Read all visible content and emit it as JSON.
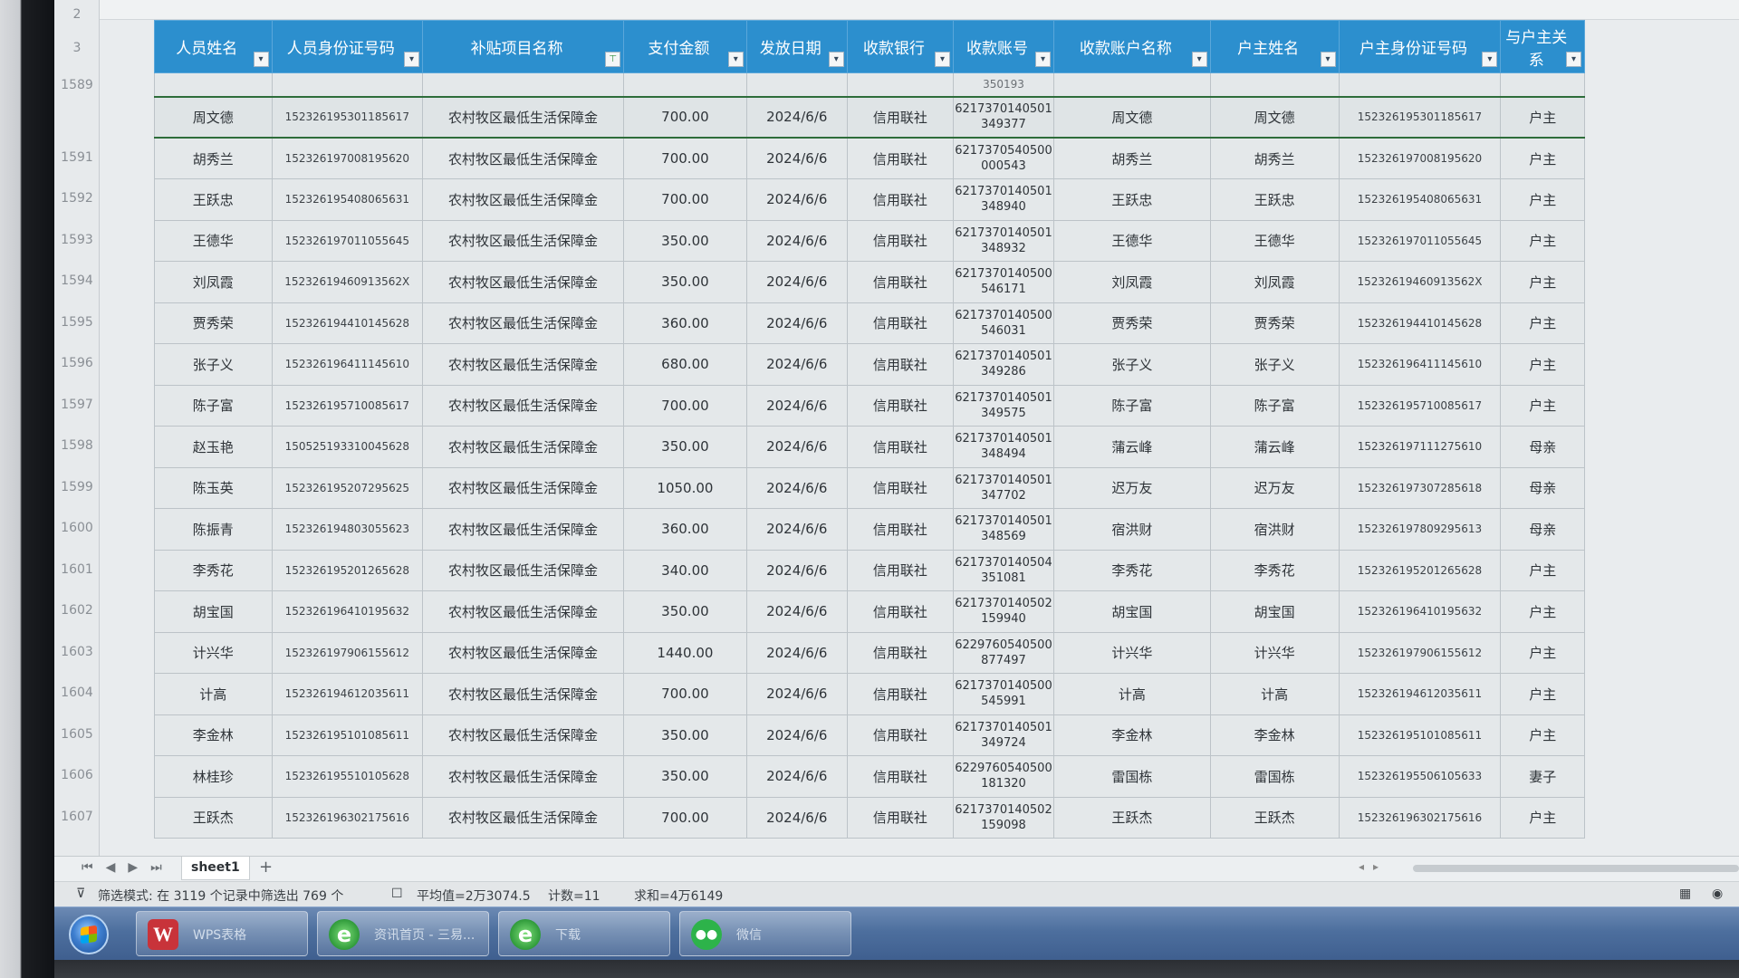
{
  "row_numbers_top": [
    "2",
    "3"
  ],
  "headers": [
    {
      "label": "人员姓名",
      "filtered": false
    },
    {
      "label": "人员身份证号码",
      "filtered": false
    },
    {
      "label": "补贴项目名称",
      "filtered": true
    },
    {
      "label": "支付金额",
      "filtered": false
    },
    {
      "label": "发放日期",
      "filtered": false
    },
    {
      "label": "收款银行",
      "filtered": false
    },
    {
      "label": "收款账号",
      "filtered": false
    },
    {
      "label": "收款账户名称",
      "filtered": false
    },
    {
      "label": "户主姓名",
      "filtered": false
    },
    {
      "label": "户主身份证号码",
      "filtered": false
    },
    {
      "label": "与户主关系",
      "filtered": false
    }
  ],
  "partial_row": {
    "num": "1589",
    "cells": [
      "",
      "",
      "",
      "",
      "",
      "",
      "350193",
      "",
      "",
      "",
      ""
    ]
  },
  "rows": [
    {
      "num": "",
      "cells": [
        "周文德",
        "152326195301185617",
        "农村牧区最低生活保障金",
        "700.00",
        "2024/6/6",
        "信用联社",
        "6217370140501\n349377",
        "周文德",
        "周文德",
        "152326195301185617",
        "户主"
      ]
    },
    {
      "num": "1591",
      "cells": [
        "胡秀兰",
        "152326197008195620",
        "农村牧区最低生活保障金",
        "700.00",
        "2024/6/6",
        "信用联社",
        "6217370540500\n000543",
        "胡秀兰",
        "胡秀兰",
        "152326197008195620",
        "户主"
      ]
    },
    {
      "num": "1592",
      "cells": [
        "王跃忠",
        "152326195408065631",
        "农村牧区最低生活保障金",
        "700.00",
        "2024/6/6",
        "信用联社",
        "6217370140501\n348940",
        "王跃忠",
        "王跃忠",
        "152326195408065631",
        "户主"
      ]
    },
    {
      "num": "1593",
      "cells": [
        "王德华",
        "152326197011055645",
        "农村牧区最低生活保障金",
        "350.00",
        "2024/6/6",
        "信用联社",
        "6217370140501\n348932",
        "王德华",
        "王德华",
        "152326197011055645",
        "户主"
      ]
    },
    {
      "num": "1594",
      "cells": [
        "刘凤霞",
        "15232619460913562X",
        "农村牧区最低生活保障金",
        "350.00",
        "2024/6/6",
        "信用联社",
        "6217370140500\n546171",
        "刘凤霞",
        "刘凤霞",
        "15232619460913562X",
        "户主"
      ]
    },
    {
      "num": "1595",
      "cells": [
        "贾秀荣",
        "152326194410145628",
        "农村牧区最低生活保障金",
        "360.00",
        "2024/6/6",
        "信用联社",
        "6217370140500\n546031",
        "贾秀荣",
        "贾秀荣",
        "152326194410145628",
        "户主"
      ]
    },
    {
      "num": "1596",
      "cells": [
        "张子义",
        "152326196411145610",
        "农村牧区最低生活保障金",
        "680.00",
        "2024/6/6",
        "信用联社",
        "6217370140501\n349286",
        "张子义",
        "张子义",
        "152326196411145610",
        "户主"
      ]
    },
    {
      "num": "1597",
      "cells": [
        "陈子富",
        "152326195710085617",
        "农村牧区最低生活保障金",
        "700.00",
        "2024/6/6",
        "信用联社",
        "6217370140501\n349575",
        "陈子富",
        "陈子富",
        "152326195710085617",
        "户主"
      ]
    },
    {
      "num": "1598",
      "cells": [
        "赵玉艳",
        "150525193310045628",
        "农村牧区最低生活保障金",
        "350.00",
        "2024/6/6",
        "信用联社",
        "6217370140501\n348494",
        "蒲云峰",
        "蒲云峰",
        "152326197111275610",
        "母亲"
      ]
    },
    {
      "num": "1599",
      "cells": [
        "陈玉英",
        "152326195207295625",
        "农村牧区最低生活保障金",
        "1050.00",
        "2024/6/6",
        "信用联社",
        "6217370140501\n347702",
        "迟万友",
        "迟万友",
        "152326197307285618",
        "母亲"
      ]
    },
    {
      "num": "1600",
      "cells": [
        "陈振青",
        "152326194803055623",
        "农村牧区最低生活保障金",
        "360.00",
        "2024/6/6",
        "信用联社",
        "6217370140501\n348569",
        "宿洪财",
        "宿洪财",
        "152326197809295613",
        "母亲"
      ]
    },
    {
      "num": "1601",
      "cells": [
        "李秀花",
        "152326195201265628",
        "农村牧区最低生活保障金",
        "340.00",
        "2024/6/6",
        "信用联社",
        "6217370140504\n351081",
        "李秀花",
        "李秀花",
        "152326195201265628",
        "户主"
      ]
    },
    {
      "num": "1602",
      "cells": [
        "胡宝国",
        "152326196410195632",
        "农村牧区最低生活保障金",
        "350.00",
        "2024/6/6",
        "信用联社",
        "6217370140502\n159940",
        "胡宝国",
        "胡宝国",
        "152326196410195632",
        "户主"
      ]
    },
    {
      "num": "1603",
      "cells": [
        "计兴华",
        "152326197906155612",
        "农村牧区最低生活保障金",
        "1440.00",
        "2024/6/6",
        "信用联社",
        "6229760540500\n877497",
        "计兴华",
        "计兴华",
        "152326197906155612",
        "户主"
      ]
    },
    {
      "num": "1604",
      "cells": [
        "计高",
        "152326194612035611",
        "农村牧区最低生活保障金",
        "700.00",
        "2024/6/6",
        "信用联社",
        "6217370140500\n545991",
        "计高",
        "计高",
        "152326194612035611",
        "户主"
      ]
    },
    {
      "num": "1605",
      "cells": [
        "李金林",
        "152326195101085611",
        "农村牧区最低生活保障金",
        "350.00",
        "2024/6/6",
        "信用联社",
        "6217370140501\n349724",
        "李金林",
        "李金林",
        "152326195101085611",
        "户主"
      ]
    },
    {
      "num": "1606",
      "cells": [
        "林桂珍",
        "152326195510105628",
        "农村牧区最低生活保障金",
        "350.00",
        "2024/6/6",
        "信用联社",
        "6229760540500\n181320",
        "雷国栋",
        "雷国栋",
        "152326195506105633",
        "妻子"
      ]
    },
    {
      "num": "1607",
      "cells": [
        "王跃杰",
        "152326196302175616",
        "农村牧区最低生活保障金",
        "700.00",
        "2024/6/6",
        "信用联社",
        "6217370140502\n159098",
        "王跃杰",
        "王跃杰",
        "152326196302175616",
        "户主"
      ]
    }
  ],
  "sheet_tab": "sheet1",
  "status": {
    "filter_text": "筛选模式: 在 3119 个记录中筛选出 769 个",
    "average": "平均值=2万3074.5",
    "count": "计数=11",
    "sum": "求和=4万6149"
  },
  "taskbar": {
    "items": [
      {
        "label": "WPS表格",
        "icon": "wps-icon"
      },
      {
        "label": "资讯首页 - 三易...",
        "icon": "ie-icon"
      },
      {
        "label": "下载",
        "icon": "ie-icon"
      },
      {
        "label": "微信",
        "icon": "wechat-icon"
      }
    ]
  },
  "colors": {
    "header_bg": "#2c8fce",
    "taskbar": "#4d6f9e"
  }
}
